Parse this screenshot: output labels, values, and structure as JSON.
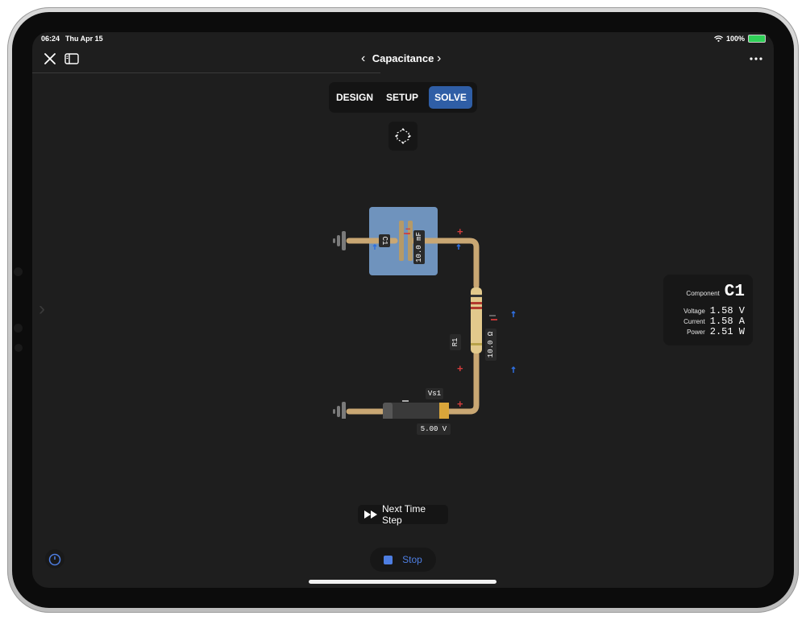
{
  "status": {
    "time": "06:24",
    "date": "Thu Apr 15",
    "battery": "100%"
  },
  "nav": {
    "title": "Capacitance"
  },
  "tabs": [
    {
      "label": "DESIGN",
      "active": false
    },
    {
      "label": "SETUP",
      "active": false
    },
    {
      "label": "SOLVE",
      "active": true
    }
  ],
  "circuit": {
    "capacitor": {
      "name": "C1",
      "value": "10.0 mF"
    },
    "resistor": {
      "name": "R1",
      "value": "10.0 Ω"
    },
    "source": {
      "name": "Vs1",
      "value": "5.00 V"
    }
  },
  "info": {
    "component_label": "Component",
    "component": "C1",
    "rows": [
      {
        "label": "Voltage",
        "value": "1.58 V"
      },
      {
        "label": "Current",
        "value": "1.58 A"
      },
      {
        "label": "Power",
        "value": "2.51 W"
      }
    ]
  },
  "controls": {
    "next_step": "Next Time Step",
    "stop": "Stop"
  },
  "colors": {
    "accent": "#2f5ea6",
    "wire": "#c9a773",
    "plus": "#d23c3c",
    "arrow": "#2f6fe0"
  },
  "icons": [
    "close-icon",
    "sidebar-icon",
    "chevron-left-icon",
    "chevron-right-icon",
    "more-icon",
    "recenter-icon",
    "fast-forward-icon",
    "stop-icon",
    "timer-icon",
    "wifi-icon",
    "battery-icon"
  ]
}
